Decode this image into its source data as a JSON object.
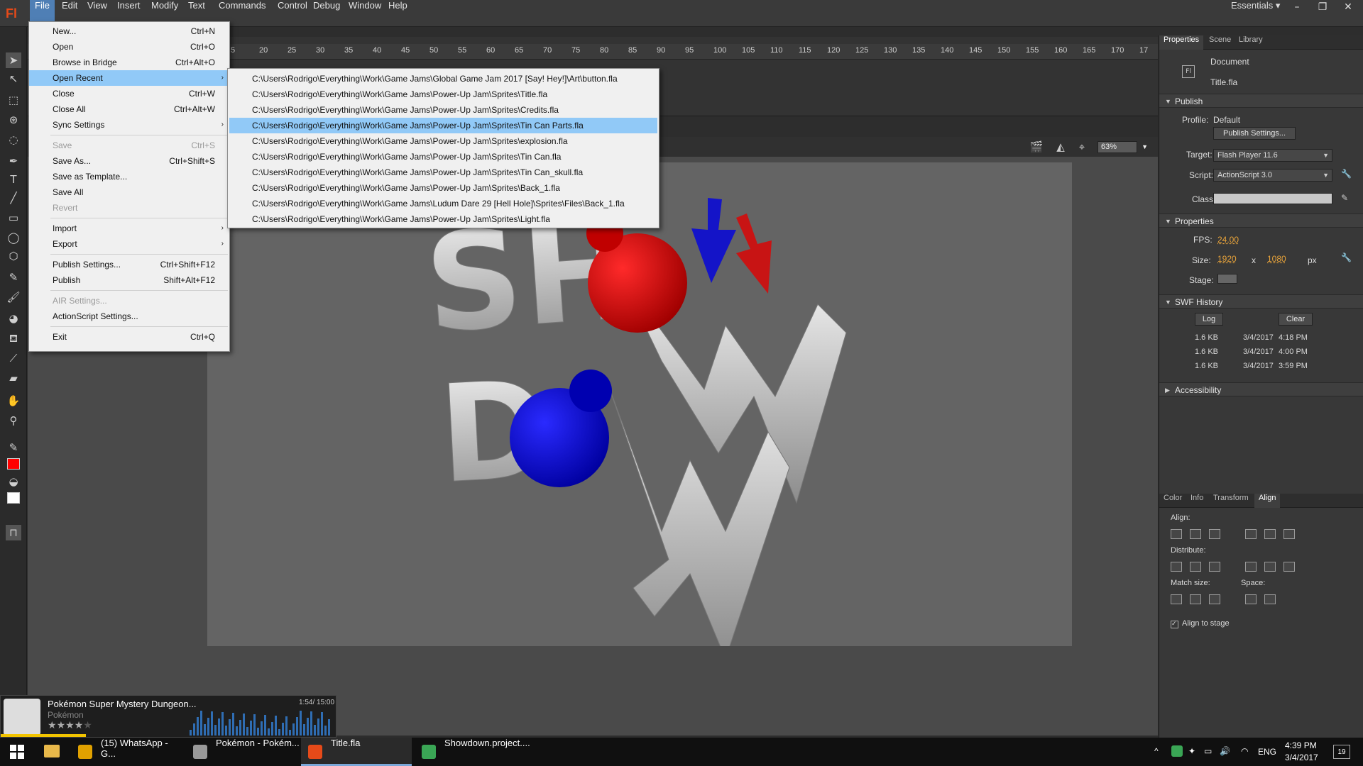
{
  "app": {
    "logo": "Fl",
    "workspace": "Essentials",
    "window_controls": [
      "minimize-icon",
      "restore-icon",
      "close-icon"
    ]
  },
  "menubar": [
    "File",
    "Edit",
    "View",
    "Insert",
    "Modify",
    "Text",
    "Commands",
    "Control",
    "Debug",
    "Window",
    "Help"
  ],
  "file_menu": {
    "items": [
      {
        "label": "New...",
        "shortcut": "Ctrl+N"
      },
      {
        "label": "Open",
        "shortcut": "Ctrl+O"
      },
      {
        "label": "Browse in Bridge",
        "shortcut": "Ctrl+Alt+O"
      },
      {
        "label": "Open Recent",
        "shortcut": "",
        "submenu": true,
        "highlighted": true
      },
      {
        "label": "Close",
        "shortcut": "Ctrl+W"
      },
      {
        "label": "Close All",
        "shortcut": "Ctrl+Alt+W"
      },
      {
        "label": "Sync Settings",
        "shortcut": "",
        "submenu": true
      },
      {
        "label": "Save",
        "shortcut": "Ctrl+S",
        "disabled": true
      },
      {
        "label": "Save As...",
        "shortcut": "Ctrl+Shift+S"
      },
      {
        "label": "Save as Template...",
        "shortcut": ""
      },
      {
        "label": "Save All",
        "shortcut": ""
      },
      {
        "label": "Revert",
        "shortcut": "",
        "disabled": true
      },
      {
        "label": "Import",
        "shortcut": "",
        "submenu": true
      },
      {
        "label": "Export",
        "shortcut": "",
        "submenu": true
      },
      {
        "label": "Publish Settings...",
        "shortcut": "Ctrl+Shift+F12"
      },
      {
        "label": "Publish",
        "shortcut": "Shift+Alt+F12"
      },
      {
        "label": "AIR Settings...",
        "shortcut": "",
        "disabled": true
      },
      {
        "label": "ActionScript Settings...",
        "shortcut": ""
      },
      {
        "label": "Exit",
        "shortcut": "Ctrl+Q"
      }
    ]
  },
  "recent_files": [
    "C:\\Users\\Rodrigo\\Everything\\Work\\Game Jams\\Global Game Jam 2017 [Say! Hey!]\\Art\\button.fla",
    "C:\\Users\\Rodrigo\\Everything\\Work\\Game Jams\\Power-Up Jam\\Sprites\\Title.fla",
    "C:\\Users\\Rodrigo\\Everything\\Work\\Game Jams\\Power-Up Jam\\Sprites\\Credits.fla",
    "C:\\Users\\Rodrigo\\Everything\\Work\\Game Jams\\Power-Up Jam\\Sprites\\Tin Can Parts.fla",
    "C:\\Users\\Rodrigo\\Everything\\Work\\Game Jams\\Power-Up Jam\\Sprites\\explosion.fla",
    "C:\\Users\\Rodrigo\\Everything\\Work\\Game Jams\\Power-Up Jam\\Sprites\\Tin Can.fla",
    "C:\\Users\\Rodrigo\\Everything\\Work\\Game Jams\\Power-Up Jam\\Sprites\\Tin Can_skull.fla",
    "C:\\Users\\Rodrigo\\Everything\\Work\\Game Jams\\Power-Up Jam\\Sprites\\Back_1.fla",
    "C:\\Users\\Rodrigo\\Everything\\Work\\Game Jams\\Ludum Dare 29 [Hell Hole]\\Sprites\\Files\\Back_1.fla",
    "C:\\Users\\Rodrigo\\Everything\\Work\\Game Jams\\Power-Up Jam\\Sprites\\Light.fla"
  ],
  "recent_highlight_index": 3,
  "ruler_ticks": [
    "5",
    "20",
    "25",
    "30",
    "35",
    "40",
    "45",
    "50",
    "55",
    "60",
    "65",
    "70",
    "75",
    "80",
    "85",
    "90",
    "95",
    "100",
    "105",
    "110",
    "115",
    "120",
    "125",
    "130",
    "135",
    "140",
    "145",
    "150",
    "155",
    "160",
    "165",
    "170",
    "17"
  ],
  "stage": {
    "zoom": "63%",
    "artwork": "SHOW DOWN"
  },
  "properties": {
    "tabs": [
      "Properties",
      "Scene",
      "Library"
    ],
    "doc_type": "Document",
    "doc_name": "Title.fla",
    "publish_section": "Publish",
    "profile_label": "Profile:",
    "profile_value": "Default",
    "publish_settings_btn": "Publish Settings...",
    "target_label": "Target:",
    "target_value": "Flash Player 11.6",
    "script_label": "Script:",
    "script_value": "ActionScript 3.0",
    "class_label": "Class:",
    "props_section": "Properties",
    "fps_label": "FPS:",
    "fps_value": "24.00",
    "size_label": "Size:",
    "width": "1920",
    "x_sep": "x",
    "height": "1080",
    "px": "px",
    "stage_label": "Stage:",
    "swf_section": "SWF History",
    "log_btn": "Log",
    "clear_btn": "Clear",
    "history": [
      {
        "size": "1.6 KB",
        "date": "3/4/2017",
        "time": "4:18 PM"
      },
      {
        "size": "1.6 KB",
        "date": "3/4/2017",
        "time": "4:00 PM"
      },
      {
        "size": "1.6 KB",
        "date": "3/4/2017",
        "time": "3:59 PM"
      }
    ],
    "accessibility_section": "Accessibility"
  },
  "align_panel": {
    "tabs": [
      "Color",
      "Info",
      "Transform",
      "Align"
    ],
    "align_label": "Align:",
    "distribute_label": "Distribute:",
    "match_label": "Match size:",
    "space_label": "Space:",
    "align_to_stage": "Align to stage"
  },
  "music": {
    "title": "Pokémon Super Mystery Dungeon...",
    "subtitle": "Pokémon",
    "time": "1:54/ 15:00",
    "rating": 4
  },
  "taskbar": {
    "apps": [
      {
        "label": "(15) WhatsApp - G...",
        "color": "#e0a100"
      },
      {
        "label": "Pokémon - Pokém...",
        "color": "#999999"
      },
      {
        "label": "Title.fla",
        "color": "#e64a19"
      },
      {
        "label": "Showdown.project....",
        "color": "#3aa655"
      }
    ],
    "lang": "ENG",
    "time": "4:39 PM",
    "date": "3/4/2017",
    "notifications": "19"
  },
  "colors": {
    "accent": "#91c9f7",
    "stroke": "#ff0000",
    "fill": "#ffffff"
  }
}
